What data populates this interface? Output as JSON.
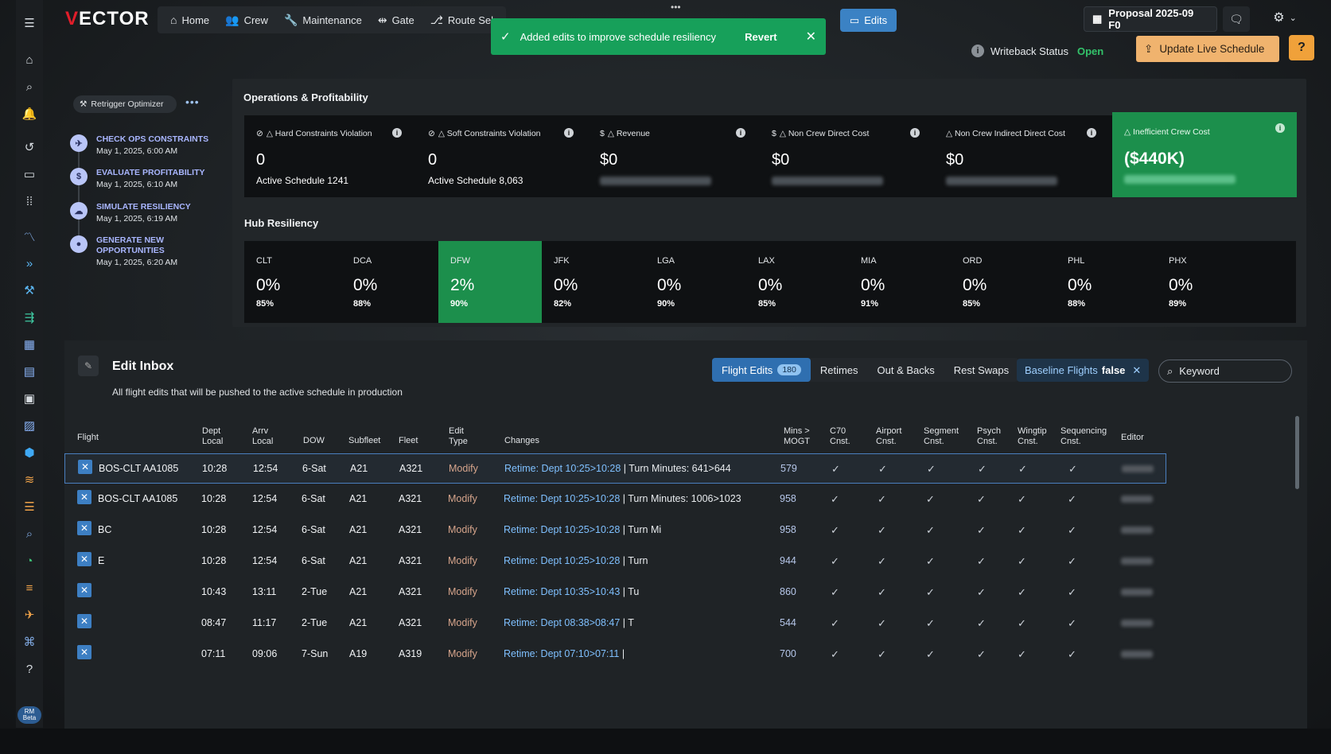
{
  "app": {
    "name_prefix": "V",
    "name_rest": "ECTOR"
  },
  "nav": [
    {
      "label": "Home",
      "icon": "⌂"
    },
    {
      "label": "Crew",
      "icon": "👥"
    },
    {
      "label": "Maintenance",
      "icon": "🔧"
    },
    {
      "label": "Gate",
      "icon": "⇹"
    },
    {
      "label": "Route Sel",
      "icon": "⎇"
    }
  ],
  "edits_button": "Edits",
  "toast": {
    "message": "Added edits to improve schedule resiliency",
    "action": "Revert"
  },
  "proposal": "Proposal 2025-09 F0",
  "writeback": {
    "label": "Writeback Status",
    "value": "Open"
  },
  "update_button": "Update Live Schedule",
  "retrigger": "Retrigger Optimizer",
  "workflow": [
    {
      "title": "CHECK OPS CONSTRAINTS",
      "date": "May 1, 2025, 6:00 AM"
    },
    {
      "title": "EVALUATE PROFITABILITY",
      "date": "May 1, 2025, 6:10 AM"
    },
    {
      "title": "SIMULATE RESILIENCY",
      "date": "May 1, 2025, 6:19 AM"
    },
    {
      "title": "GENERATE NEW OPPORTUNITIES",
      "date": "May 1, 2025, 6:20 AM"
    }
  ],
  "ops": {
    "title": "Operations & Profitability",
    "cards": [
      {
        "label": "△ Hard Constraints Violation",
        "value": "0",
        "sub": "Active Schedule 1241"
      },
      {
        "label": "△ Soft Constraints Violation",
        "value": "0",
        "sub": "Active Schedule 8,063"
      },
      {
        "label": "△ Revenue",
        "value": "$0"
      },
      {
        "label": "△ Non Crew Direct Cost",
        "value": "$0"
      },
      {
        "label": "△ Non Crew Indirect Direct Cost",
        "value": "$0"
      }
    ],
    "crew_card": {
      "label": "△ Inefficient Crew Cost",
      "value": "($440K)"
    }
  },
  "hub": {
    "title": "Hub Resiliency",
    "items": [
      {
        "code": "CLT",
        "pct": "0%",
        "score": "85%"
      },
      {
        "code": "DCA",
        "pct": "0%",
        "score": "88%"
      },
      {
        "code": "DFW",
        "pct": "2%",
        "score": "90%"
      },
      {
        "code": "JFK",
        "pct": "0%",
        "score": "82%"
      },
      {
        "code": "LGA",
        "pct": "0%",
        "score": "90%"
      },
      {
        "code": "LAX",
        "pct": "0%",
        "score": "85%"
      },
      {
        "code": "MIA",
        "pct": "0%",
        "score": "91%"
      },
      {
        "code": "ORD",
        "pct": "0%",
        "score": "85%"
      },
      {
        "code": "PHL",
        "pct": "0%",
        "score": "88%"
      },
      {
        "code": "PHX",
        "pct": "0%",
        "score": "89%"
      }
    ]
  },
  "inbox": {
    "title": "Edit Inbox",
    "description": "All flight edits that will be pushed to the active schedule in production",
    "tabs": [
      {
        "label": "Flight Edits",
        "count": "180"
      },
      {
        "label": "Retimes"
      },
      {
        "label": "Out & Backs"
      },
      {
        "label": "Rest Swaps"
      }
    ],
    "filter": {
      "label": "Baseline Flights",
      "value": "false"
    },
    "search_placeholder": "Keyword",
    "columns": {
      "flight": "Flight",
      "dept_local": "Dept\nLocal",
      "arrv_local": "Arrv\nLocal",
      "dow": "DOW",
      "subfleet": "Subfleet",
      "fleet": "Fleet",
      "edit_type": "Edit\nType",
      "changes": "Changes",
      "mins_mogt": "Mins >\nMOGT",
      "c70": "C70\nCnst.",
      "airport": "Airport\nCnst.",
      "segment": "Segment\nCnst.",
      "psych": "Psych\nCnst.",
      "wingtip": "Wingtip\nCnst.",
      "sequencing": "Sequencing\nCnst.",
      "editor": "Editor"
    },
    "check": "✓",
    "rows": [
      {
        "flight": "BOS-CLT AA1085",
        "dept": "10:28",
        "arrv": "12:54",
        "dow": "6-Sat",
        "subfleet": "A21",
        "fleet": "A321",
        "type": "Modify",
        "change": "Retime: Dept 10:25>10:28",
        "change2": "| Turn Minutes: 641>644",
        "mins": "579"
      },
      {
        "flight": "BOS-CLT AA1085",
        "dept": "10:28",
        "arrv": "12:54",
        "dow": "6-Sat",
        "subfleet": "A21",
        "fleet": "A321",
        "type": "Modify",
        "change": "Retime: Dept 10:25>10:28",
        "change2": "| Turn Minutes: 1006>1023",
        "mins": "958"
      },
      {
        "flight": "BC",
        "dept": "10:28",
        "arrv": "12:54",
        "dow": "6-Sat",
        "subfleet": "A21",
        "fleet": "A321",
        "type": "Modify",
        "change": "Retime: Dept 10:25>10:28",
        "change2": "| Turn Mi",
        "mins": "958"
      },
      {
        "flight": "E",
        "dept": "10:28",
        "arrv": "12:54",
        "dow": "6-Sat",
        "subfleet": "A21",
        "fleet": "A321",
        "type": "Modify",
        "change": "Retime: Dept 10:25>10:28",
        "change2": "| Turn",
        "mins": "944"
      },
      {
        "flight": "",
        "dept": "10:43",
        "arrv": "13:11",
        "dow": "2-Tue",
        "subfleet": "A21",
        "fleet": "A321",
        "type": "Modify",
        "change": "Retime: Dept 10:35>10:43",
        "change2": "| Tu",
        "mins": "860"
      },
      {
        "flight": "",
        "dept": "08:47",
        "arrv": "11:17",
        "dow": "2-Tue",
        "subfleet": "A21",
        "fleet": "A321",
        "type": "Modify",
        "change": "Retime: Dept 08:38>08:47",
        "change2": "| T",
        "mins": "544"
      },
      {
        "flight": "",
        "dept": "07:11",
        "arrv": "09:06",
        "dow": "7-Sun",
        "subfleet": "A19",
        "fleet": "A319",
        "type": "Modify",
        "change": "Retime: Dept 07:10>07:11",
        "change2": "|",
        "mins": "700"
      }
    ]
  }
}
